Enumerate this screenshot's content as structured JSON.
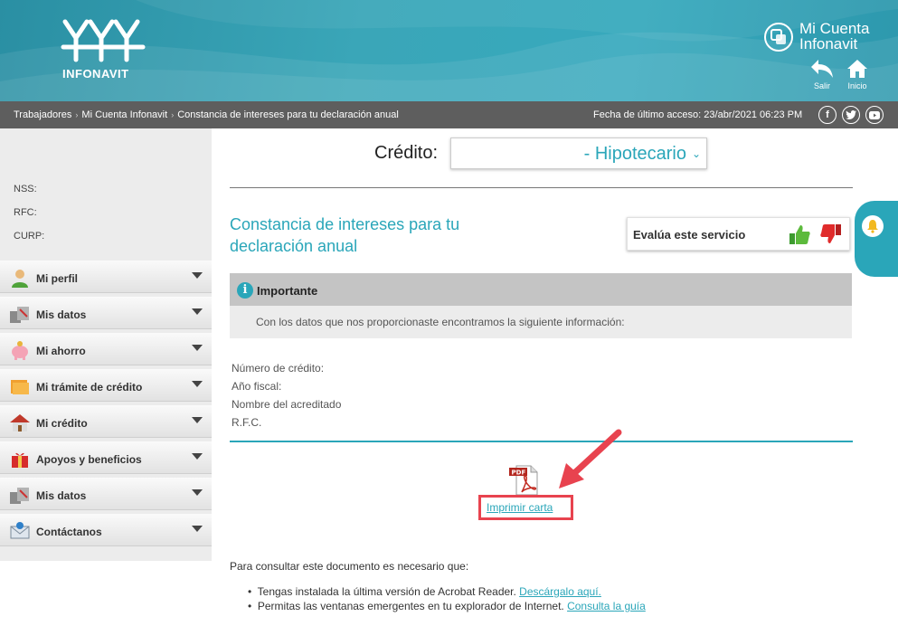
{
  "header": {
    "brand": "INFONAVIT",
    "account_title_1": "Mi Cuenta",
    "account_title_2": "Infonavit",
    "logout_label": "Salir",
    "home_label": "Inicio"
  },
  "breadcrumb": {
    "items": [
      "Trabajadores",
      "Mi Cuenta Infonavit",
      "Constancia de intereses para tu declaración anual"
    ],
    "last_access": "Fecha de último acceso: 23/abr/2021 06:23 PM"
  },
  "sidebar": {
    "nss_label": "NSS:",
    "rfc_label": "RFC:",
    "curp_label": "CURP:",
    "menu": [
      {
        "label": "Mi perfil",
        "icon": "user-icon"
      },
      {
        "label": "Mis datos",
        "icon": "boxes-icon"
      },
      {
        "label": "Mi ahorro",
        "icon": "piggy-bank-icon"
      },
      {
        "label": "Mi trámite de crédito",
        "icon": "folder-icon"
      },
      {
        "label": "Mi crédito",
        "icon": "house-icon"
      },
      {
        "label": "Apoyos y beneficios",
        "icon": "gift-icon"
      },
      {
        "label": "Mis datos",
        "icon": "boxes-icon"
      },
      {
        "label": "Contáctanos",
        "icon": "mail-icon"
      }
    ]
  },
  "main": {
    "credit_label": "Crédito:",
    "credit_value": "- Hipotecario",
    "title": "Constancia de intereses para tu declaración anual",
    "evaluate_label": "Evalúa este servicio",
    "important_title": "Importante",
    "important_text": "Con los datos que nos proporcionaste encontramos la siguiente información:",
    "fields": [
      "Número de crédito:",
      "Año fiscal:",
      "Nombre del acreditado",
      "R.F.C."
    ],
    "pdf_label": "PDF",
    "print_link": "Imprimir carta",
    "note": "Para consultar este documento es necesario que:",
    "bullet1_text": "Tengas instalada la última versión de Acrobat Reader. ",
    "bullet1_link": "Descárgalo aquí.",
    "bullet2_text": "Permitas las ventanas emergentes en tu explorador de Internet. ",
    "bullet2_link": "Consulta la guía"
  },
  "colors": {
    "accent": "#2aa6b9",
    "highlight": "#e8434f",
    "breadcrumb_bg": "#5e5e5e"
  }
}
